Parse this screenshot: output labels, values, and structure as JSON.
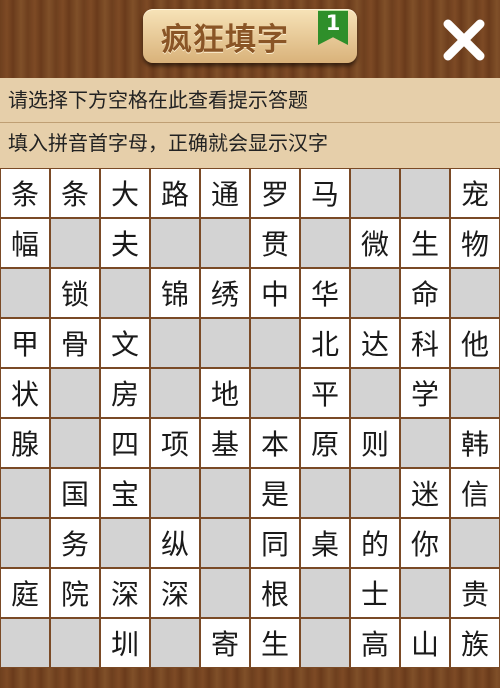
{
  "header": {
    "title": "疯狂填字",
    "level": "1",
    "close_icon": "close-x-icon"
  },
  "hints": {
    "line1": "请选择下方空格在此查看提示答题",
    "line2": "填入拼音首字母，正确就会显示汉字"
  },
  "colors": {
    "letter_cell": "#ffffff",
    "empty_cell": "#d3d3d3",
    "grid_line": "#7a4a26",
    "wood": "#7a4a26",
    "hint_bar": "#e6cfaa",
    "badge": "#2f8f2a"
  },
  "grid": [
    [
      "条",
      "条",
      "大",
      "路",
      "通",
      "罗",
      "马",
      "",
      "",
      "宠"
    ],
    [
      "幅",
      "",
      "夫",
      "",
      "",
      "贯",
      "",
      "微",
      "生",
      "物"
    ],
    [
      "",
      "锁",
      "",
      "锦",
      "绣",
      "中",
      "华",
      "",
      "命",
      ""
    ],
    [
      "甲",
      "骨",
      "文",
      "",
      "",
      "",
      "北",
      "达",
      "科",
      "他"
    ],
    [
      "状",
      "",
      "房",
      "",
      "地",
      "",
      "平",
      "",
      "学",
      ""
    ],
    [
      "腺",
      "",
      "四",
      "项",
      "基",
      "本",
      "原",
      "则",
      "",
      "韩"
    ],
    [
      "",
      "国",
      "宝",
      "",
      "",
      "是",
      "",
      "",
      "迷",
      "信"
    ],
    [
      "",
      "务",
      "",
      "纵",
      "",
      "同",
      "桌",
      "的",
      "你",
      ""
    ],
    [
      "庭",
      "院",
      "深",
      "深",
      "",
      "根",
      "",
      "士",
      "",
      "贵"
    ],
    [
      "",
      "",
      "圳",
      "",
      "寄",
      "生",
      "",
      "高",
      "山",
      "族"
    ]
  ],
  "grid_cells": [
    [
      "w",
      "w",
      "w",
      "w",
      "w",
      "w",
      "w",
      "g",
      "g",
      "w"
    ],
    [
      "w",
      "g",
      "w",
      "g",
      "g",
      "w",
      "g",
      "w",
      "w",
      "w"
    ],
    [
      "g",
      "w",
      "g",
      "w",
      "w",
      "w",
      "w",
      "g",
      "w",
      "g"
    ],
    [
      "w",
      "w",
      "w",
      "g",
      "g",
      "g",
      "w",
      "w",
      "w",
      "w"
    ],
    [
      "w",
      "g",
      "w",
      "g",
      "w",
      "g",
      "w",
      "g",
      "w",
      "g"
    ],
    [
      "w",
      "g",
      "w",
      "w",
      "w",
      "w",
      "w",
      "w",
      "g",
      "w"
    ],
    [
      "g",
      "w",
      "w",
      "g",
      "g",
      "w",
      "g",
      "g",
      "w",
      "w"
    ],
    [
      "g",
      "w",
      "g",
      "w",
      "g",
      "w",
      "w",
      "w",
      "w",
      "g"
    ],
    [
      "w",
      "w",
      "w",
      "w",
      "g",
      "w",
      "g",
      "w",
      "g",
      "w"
    ],
    [
      "g",
      "g",
      "w",
      "g",
      "w",
      "w",
      "g",
      "w",
      "w",
      "w"
    ]
  ]
}
